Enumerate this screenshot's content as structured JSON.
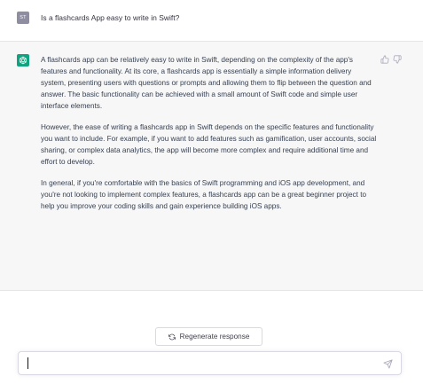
{
  "user_message": {
    "avatar_initials": "ST",
    "text": "Is a flashcards App easy to write in Swift?"
  },
  "assistant_message": {
    "avatar_icon": "openai-logo-icon",
    "paragraphs": [
      "A flashcards app can be relatively easy to write in Swift, depending on the complexity of the app's features and functionality. At its core, a flashcards app is essentially a simple information delivery system, presenting users with questions or prompts and allowing them to flip between the question and answer. The basic functionality can be achieved with a small amount of Swift code and simple user interface elements.",
      "However, the ease of writing a flashcards app in Swift depends on the specific features and functionality you want to include. For example, if you want to add features such as gamification, user accounts, social sharing, or complex data analytics, the app will become more complex and require additional time and effort to develop.",
      "In general, if you're comfortable with the basics of Swift programming and iOS app development, and you're not looking to implement complex features, a flashcards app can be a great beginner project to help you improve your coding skills and gain experience building iOS apps."
    ],
    "feedback_icons": [
      "thumbs-up-icon",
      "thumbs-down-icon"
    ]
  },
  "regenerate_button": {
    "label": "Regenerate response",
    "icon": "refresh-icon"
  },
  "composer": {
    "value": "",
    "send_icon": "send-icon"
  },
  "colors": {
    "assistant_bg": "#f7f7f8",
    "bot_avatar": "#10a37f",
    "user_avatar": "#8e8ea0",
    "border": "#d9d9e3"
  }
}
